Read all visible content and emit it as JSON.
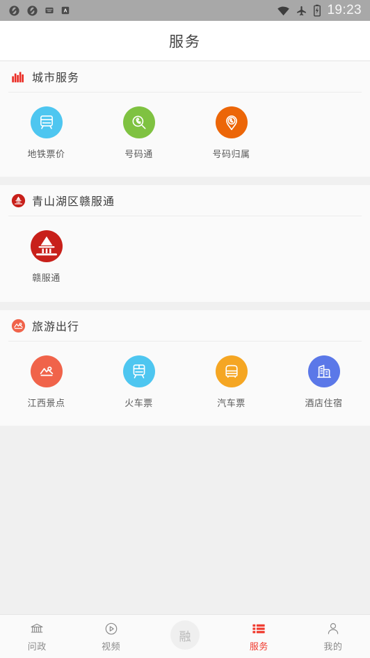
{
  "status_bar": {
    "left_icons": [
      "app-sync-icon",
      "app-sync-icon-2",
      "mail-icon",
      "badge-a-icon"
    ],
    "wifi_icon": "wifi-icon",
    "airplane_icon": "airplane-mode-icon",
    "battery_icon": "battery-charging-icon",
    "time": "19:23"
  },
  "header": {
    "title": "服务"
  },
  "colors": {
    "accent_red": "#f03a2e",
    "metro_blue": "#4ec6f0",
    "phone_green": "#7fc241",
    "pin_orange": "#ec6608",
    "ganfutong_red": "#c8201a",
    "scenic_coral": "#f0634a",
    "train_cyan": "#4ec6f0",
    "bus_amber": "#f5a623",
    "hotel_blue": "#5b78e8"
  },
  "sections": [
    {
      "id": "city-services",
      "icon": "city-skyline-icon",
      "title": "城市服务",
      "items": [
        {
          "label": "地铁票价",
          "icon": "metro-train-icon",
          "color": "#4ec6f0"
        },
        {
          "label": "号码通",
          "icon": "phone-search-icon",
          "color": "#7fc241"
        },
        {
          "label": "号码归属",
          "icon": "phone-location-pin-icon",
          "color": "#ec6608"
        }
      ]
    },
    {
      "id": "qingshanhu-ganfutong",
      "icon": "pavilion-icon",
      "title": "青山湖区赣服通",
      "items": [
        {
          "label": "赣服通",
          "icon": "pavilion-icon",
          "color": "#c8201a"
        }
      ]
    },
    {
      "id": "tourism-travel",
      "icon": "mountain-icon",
      "title": "旅游出行",
      "items": [
        {
          "label": "江西景点",
          "icon": "mountain-sun-icon",
          "color": "#f0634a"
        },
        {
          "label": "火车票",
          "icon": "train-icon",
          "color": "#4ec6f0"
        },
        {
          "label": "汽车票",
          "icon": "bus-icon",
          "color": "#f5a623"
        },
        {
          "label": "酒店住宿",
          "icon": "hotel-building-icon",
          "color": "#5b78e8"
        }
      ]
    }
  ],
  "tabbar": {
    "items": [
      {
        "label": "问政",
        "icon": "government-building-icon",
        "active": false
      },
      {
        "label": "视频",
        "icon": "play-circle-icon",
        "active": false
      },
      {
        "label": "融",
        "icon": "rong-fab-icon",
        "active": false,
        "center": true
      },
      {
        "label": "服务",
        "icon": "list-icon",
        "active": true
      },
      {
        "label": "我的",
        "icon": "person-icon",
        "active": false
      }
    ]
  }
}
